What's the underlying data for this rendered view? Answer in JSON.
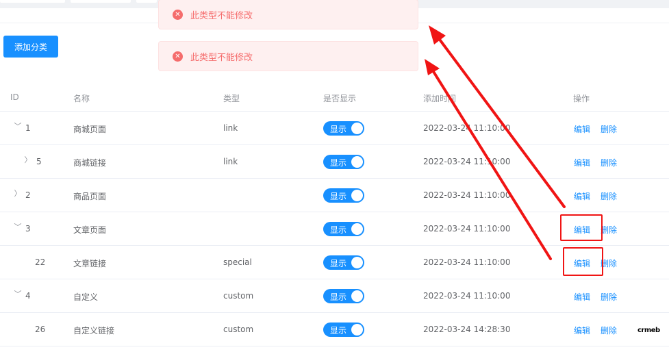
{
  "toolbar": {
    "add_label": "添加分类"
  },
  "toasts": [
    {
      "message": "此类型不能修改"
    },
    {
      "message": "此类型不能修改"
    }
  ],
  "table": {
    "headers": [
      "ID",
      "名称",
      "类型",
      "是否显示",
      "添加时间",
      "操作"
    ],
    "toggle_label": "显示",
    "edit_label": "编辑",
    "delete_label": "删除",
    "rows": [
      {
        "id": "1",
        "name": "商城页面",
        "type": "link",
        "time": "2022-03-24 11:10:00",
        "expander": "expanded"
      },
      {
        "id": "5",
        "name": "商城链接",
        "type": "link",
        "time": "2022-03-24 11:10:00",
        "expander": "collapsed"
      },
      {
        "id": "2",
        "name": "商品页面",
        "type": "",
        "time": "2022-03-24 11:10:00",
        "expander": "collapsed"
      },
      {
        "id": "3",
        "name": "文章页面",
        "type": "",
        "time": "2022-03-24 11:10:00",
        "expander": "expanded"
      },
      {
        "id": "22",
        "name": "文章链接",
        "type": "special",
        "time": "2022-03-24 11:10:00",
        "expander": "none"
      },
      {
        "id": "4",
        "name": "自定义",
        "type": "custom",
        "time": "2022-03-24 11:10:00",
        "expander": "expanded"
      },
      {
        "id": "26",
        "name": "自定义链接",
        "type": "custom",
        "time": "2022-03-24 14:28:30",
        "expander": "none"
      }
    ]
  },
  "watermark": "crmeb",
  "colors": {
    "primary": "#1890ff",
    "error": "#f56c6c",
    "annotation": "#f01414"
  }
}
